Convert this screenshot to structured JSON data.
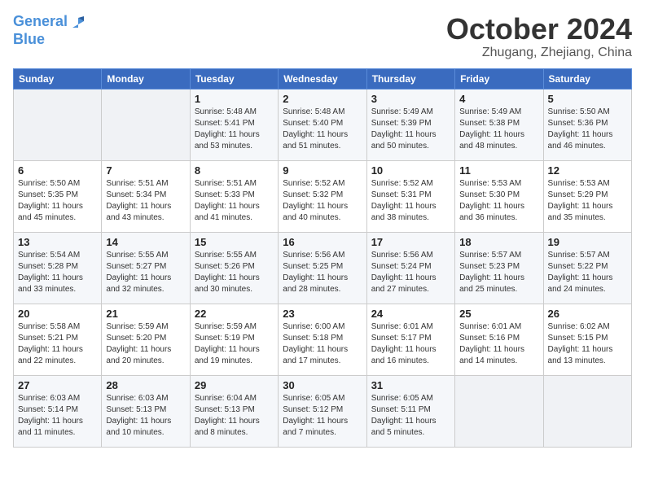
{
  "logo": {
    "line1": "General",
    "line2": "Blue"
  },
  "title": "October 2024",
  "location": "Zhugang, Zhejiang, China",
  "weekdays": [
    "Sunday",
    "Monday",
    "Tuesday",
    "Wednesday",
    "Thursday",
    "Friday",
    "Saturday"
  ],
  "weeks": [
    [
      {
        "day": "",
        "info": ""
      },
      {
        "day": "",
        "info": ""
      },
      {
        "day": "1",
        "info": "Sunrise: 5:48 AM\nSunset: 5:41 PM\nDaylight: 11 hours and 53 minutes."
      },
      {
        "day": "2",
        "info": "Sunrise: 5:48 AM\nSunset: 5:40 PM\nDaylight: 11 hours and 51 minutes."
      },
      {
        "day": "3",
        "info": "Sunrise: 5:49 AM\nSunset: 5:39 PM\nDaylight: 11 hours and 50 minutes."
      },
      {
        "day": "4",
        "info": "Sunrise: 5:49 AM\nSunset: 5:38 PM\nDaylight: 11 hours and 48 minutes."
      },
      {
        "day": "5",
        "info": "Sunrise: 5:50 AM\nSunset: 5:36 PM\nDaylight: 11 hours and 46 minutes."
      }
    ],
    [
      {
        "day": "6",
        "info": "Sunrise: 5:50 AM\nSunset: 5:35 PM\nDaylight: 11 hours and 45 minutes."
      },
      {
        "day": "7",
        "info": "Sunrise: 5:51 AM\nSunset: 5:34 PM\nDaylight: 11 hours and 43 minutes."
      },
      {
        "day": "8",
        "info": "Sunrise: 5:51 AM\nSunset: 5:33 PM\nDaylight: 11 hours and 41 minutes."
      },
      {
        "day": "9",
        "info": "Sunrise: 5:52 AM\nSunset: 5:32 PM\nDaylight: 11 hours and 40 minutes."
      },
      {
        "day": "10",
        "info": "Sunrise: 5:52 AM\nSunset: 5:31 PM\nDaylight: 11 hours and 38 minutes."
      },
      {
        "day": "11",
        "info": "Sunrise: 5:53 AM\nSunset: 5:30 PM\nDaylight: 11 hours and 36 minutes."
      },
      {
        "day": "12",
        "info": "Sunrise: 5:53 AM\nSunset: 5:29 PM\nDaylight: 11 hours and 35 minutes."
      }
    ],
    [
      {
        "day": "13",
        "info": "Sunrise: 5:54 AM\nSunset: 5:28 PM\nDaylight: 11 hours and 33 minutes."
      },
      {
        "day": "14",
        "info": "Sunrise: 5:55 AM\nSunset: 5:27 PM\nDaylight: 11 hours and 32 minutes."
      },
      {
        "day": "15",
        "info": "Sunrise: 5:55 AM\nSunset: 5:26 PM\nDaylight: 11 hours and 30 minutes."
      },
      {
        "day": "16",
        "info": "Sunrise: 5:56 AM\nSunset: 5:25 PM\nDaylight: 11 hours and 28 minutes."
      },
      {
        "day": "17",
        "info": "Sunrise: 5:56 AM\nSunset: 5:24 PM\nDaylight: 11 hours and 27 minutes."
      },
      {
        "day": "18",
        "info": "Sunrise: 5:57 AM\nSunset: 5:23 PM\nDaylight: 11 hours and 25 minutes."
      },
      {
        "day": "19",
        "info": "Sunrise: 5:57 AM\nSunset: 5:22 PM\nDaylight: 11 hours and 24 minutes."
      }
    ],
    [
      {
        "day": "20",
        "info": "Sunrise: 5:58 AM\nSunset: 5:21 PM\nDaylight: 11 hours and 22 minutes."
      },
      {
        "day": "21",
        "info": "Sunrise: 5:59 AM\nSunset: 5:20 PM\nDaylight: 11 hours and 20 minutes."
      },
      {
        "day": "22",
        "info": "Sunrise: 5:59 AM\nSunset: 5:19 PM\nDaylight: 11 hours and 19 minutes."
      },
      {
        "day": "23",
        "info": "Sunrise: 6:00 AM\nSunset: 5:18 PM\nDaylight: 11 hours and 17 minutes."
      },
      {
        "day": "24",
        "info": "Sunrise: 6:01 AM\nSunset: 5:17 PM\nDaylight: 11 hours and 16 minutes."
      },
      {
        "day": "25",
        "info": "Sunrise: 6:01 AM\nSunset: 5:16 PM\nDaylight: 11 hours and 14 minutes."
      },
      {
        "day": "26",
        "info": "Sunrise: 6:02 AM\nSunset: 5:15 PM\nDaylight: 11 hours and 13 minutes."
      }
    ],
    [
      {
        "day": "27",
        "info": "Sunrise: 6:03 AM\nSunset: 5:14 PM\nDaylight: 11 hours and 11 minutes."
      },
      {
        "day": "28",
        "info": "Sunrise: 6:03 AM\nSunset: 5:13 PM\nDaylight: 11 hours and 10 minutes."
      },
      {
        "day": "29",
        "info": "Sunrise: 6:04 AM\nSunset: 5:13 PM\nDaylight: 11 hours and 8 minutes."
      },
      {
        "day": "30",
        "info": "Sunrise: 6:05 AM\nSunset: 5:12 PM\nDaylight: 11 hours and 7 minutes."
      },
      {
        "day": "31",
        "info": "Sunrise: 6:05 AM\nSunset: 5:11 PM\nDaylight: 11 hours and 5 minutes."
      },
      {
        "day": "",
        "info": ""
      },
      {
        "day": "",
        "info": ""
      }
    ]
  ]
}
